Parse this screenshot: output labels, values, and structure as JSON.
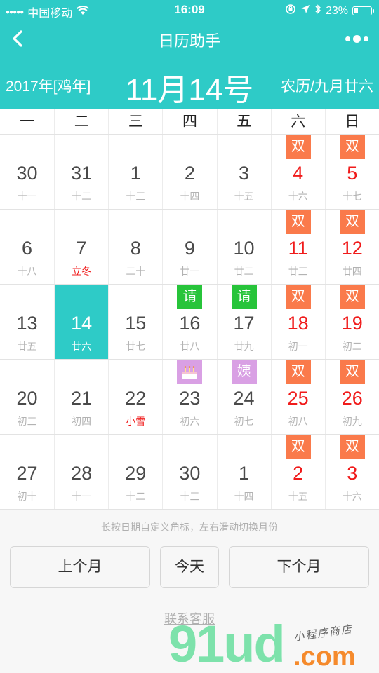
{
  "status_bar": {
    "carrier": "中国移动",
    "time": "16:09",
    "battery_text": "23%",
    "battery_level": 0.23
  },
  "nav": {
    "title": "日历助手"
  },
  "header": {
    "year": "2017年[鸡年]",
    "date": "11月14号",
    "lunar": "农历/九月廿六"
  },
  "weekdays": [
    "一",
    "二",
    "三",
    "四",
    "五",
    "六",
    "日"
  ],
  "weeks": [
    [
      {
        "num": "30",
        "lunar": "十一"
      },
      {
        "num": "31",
        "lunar": "十二"
      },
      {
        "num": "1",
        "lunar": "十三"
      },
      {
        "num": "2",
        "lunar": "十四"
      },
      {
        "num": "3",
        "lunar": "十五"
      },
      {
        "num": "4",
        "lunar": "十六",
        "tag": "双"
      },
      {
        "num": "5",
        "lunar": "十七",
        "tag": "双"
      }
    ],
    [
      {
        "num": "6",
        "lunar": "十八"
      },
      {
        "num": "7",
        "lunar": "立冬"
      },
      {
        "num": "8",
        "lunar": "二十"
      },
      {
        "num": "9",
        "lunar": "廿一"
      },
      {
        "num": "10",
        "lunar": "廿二"
      },
      {
        "num": "11",
        "lunar": "廿三",
        "tag": "双"
      },
      {
        "num": "12",
        "lunar": "廿四",
        "tag": "双"
      }
    ],
    [
      {
        "num": "13",
        "lunar": "廿五"
      },
      {
        "num": "14",
        "lunar": "廿六"
      },
      {
        "num": "15",
        "lunar": "廿七"
      },
      {
        "num": "16",
        "lunar": "廿八",
        "tag": "请"
      },
      {
        "num": "17",
        "lunar": "廿九",
        "tag": "请"
      },
      {
        "num": "18",
        "lunar": "初一",
        "tag": "双"
      },
      {
        "num": "19",
        "lunar": "初二",
        "tag": "双"
      }
    ],
    [
      {
        "num": "20",
        "lunar": "初三"
      },
      {
        "num": "21",
        "lunar": "初四"
      },
      {
        "num": "22",
        "lunar": "小雪"
      },
      {
        "num": "23",
        "lunar": "初六",
        "tag_icon": "birthday-cake-icon"
      },
      {
        "num": "24",
        "lunar": "初七",
        "tag": "姨"
      },
      {
        "num": "25",
        "lunar": "初八",
        "tag": "双"
      },
      {
        "num": "26",
        "lunar": "初九",
        "tag": "双"
      }
    ],
    [
      {
        "num": "27",
        "lunar": "初十"
      },
      {
        "num": "28",
        "lunar": "十一"
      },
      {
        "num": "29",
        "lunar": "十二"
      },
      {
        "num": "30",
        "lunar": "十三"
      },
      {
        "num": "1",
        "lunar": "十四"
      },
      {
        "num": "2",
        "lunar": "十五",
        "tag": "双"
      },
      {
        "num": "3",
        "lunar": "十六",
        "tag": "双"
      }
    ]
  ],
  "tip": "长按日期自定义角标，左右滑动切换月份",
  "buttons": {
    "prev": "上个月",
    "today": "今天",
    "next": "下个月"
  },
  "contact": "联系客服",
  "watermark": {
    "main": "91ud",
    "suffix": ".com",
    "slogan": "小程序商店"
  },
  "colors": {
    "accent": "#2ecbc7",
    "weekend": "#f01b1b",
    "rest_tag": "#fa7a4b",
    "leave_tag": "#27c43a",
    "period_tag": "#d9a0e4"
  }
}
